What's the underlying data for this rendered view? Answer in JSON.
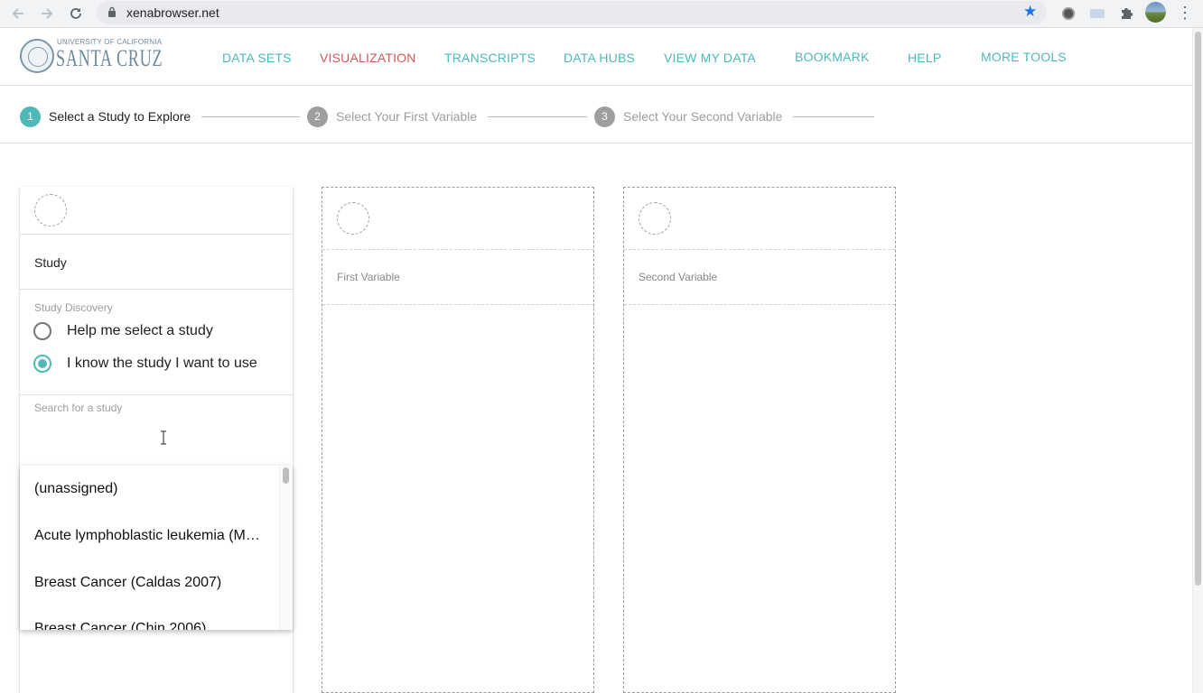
{
  "browser": {
    "url": "xenabrowser.net"
  },
  "site": {
    "logo_top": "UNIVERSITY OF CALIFORNIA",
    "logo_main": "SANTA CRUZ",
    "menu": [
      {
        "label": "DATA SETS"
      },
      {
        "label": "VISUALIZATION",
        "active": true
      },
      {
        "label": "TRANSCRIPTS"
      },
      {
        "label": "DATA HUBS"
      },
      {
        "label": "VIEW MY DATA"
      },
      {
        "label": "BOOKMARK"
      },
      {
        "label": "HELP"
      },
      {
        "label": "MORE TOOLS"
      }
    ]
  },
  "stepper": {
    "steps": [
      {
        "number": "1",
        "label": "Select a Study to Explore",
        "active": true
      },
      {
        "number": "2",
        "label": "Select Your First Variable",
        "active": false
      },
      {
        "number": "3",
        "label": "Select Your Second Variable",
        "active": false
      }
    ]
  },
  "study_card": {
    "title": "Study",
    "discovery_label": "Study Discovery",
    "options": [
      {
        "label": "Help me select a study",
        "checked": false
      },
      {
        "label": "I know the study I want to use",
        "checked": true
      }
    ],
    "search_placeholder": "Search for a study",
    "search_value": ""
  },
  "study_list": [
    "(unassigned)",
    "Acute lymphoblastic leukemia (M…",
    "Breast Cancer (Caldas 2007)",
    "Breast Cancer (Chin 2006)"
  ],
  "first_card": {
    "title": "First Variable"
  },
  "second_card": {
    "title": "Second Variable"
  },
  "colors": {
    "accent": "#4fb8b8",
    "active_menu": "#d25a5e",
    "inactive_step": "#9e9e9e"
  }
}
